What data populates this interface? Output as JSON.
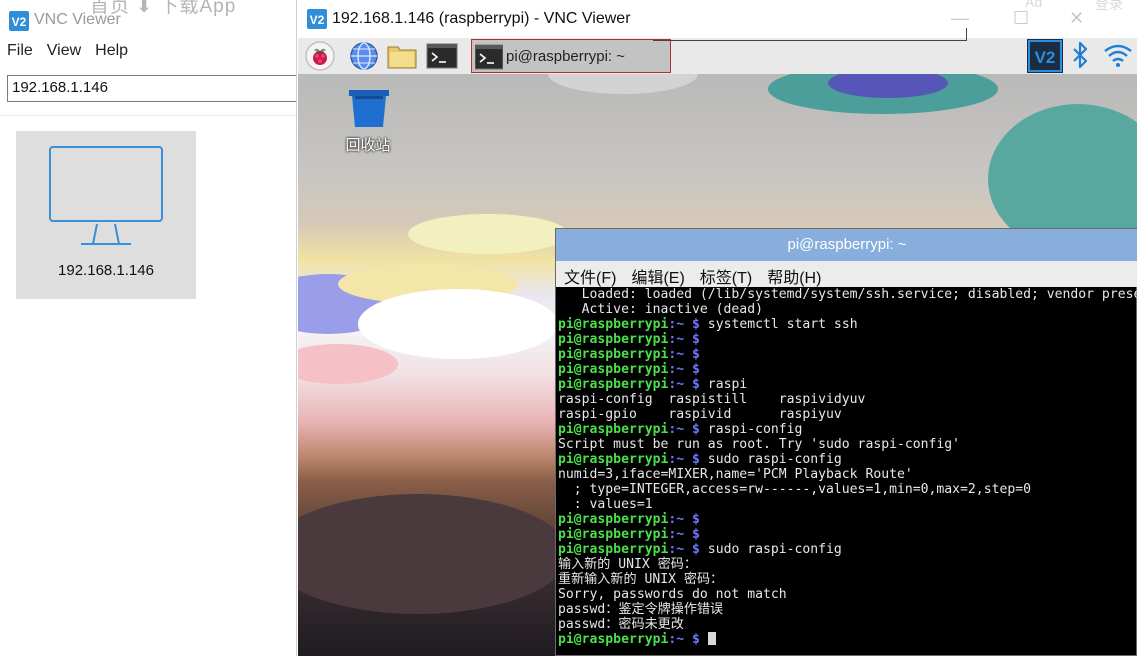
{
  "left_window": {
    "title": "VNC Viewer",
    "ghost_text": "首页  ⬇ 下载App",
    "menu": [
      "File",
      "View",
      "Help"
    ],
    "address_value": "192.168.1.146",
    "tile_label": "192.168.1.146"
  },
  "vnc_window": {
    "title": "192.168.1.146 (raspberrypi) - VNC Viewer",
    "controls": {
      "minimize": "—",
      "maximize": "☐",
      "close": "✕"
    },
    "ghost_ad": "Ad",
    "ghost_login": "登录"
  },
  "pi_panel": {
    "taskbar_label": "pi@raspberrypi: ~"
  },
  "desktop": {
    "trash_label": "回收站"
  },
  "terminal": {
    "title": "pi@raspberrypi: ~",
    "menu": [
      "文件(F)",
      "编辑(E)",
      "标签(T)",
      "帮助(H)"
    ],
    "prompt_user": "pi@raspberrypi",
    "prompt_path": ":~ $",
    "lines": [
      {
        "kind": "out",
        "text": "   Loaded: loaded (/lib/systemd/system/ssh.service; disabled; vendor preset: enabled)"
      },
      {
        "kind": "out",
        "text": "   Active: inactive (dead)"
      },
      {
        "kind": "cmd",
        "text": " systemctl start ssh"
      },
      {
        "kind": "cmd",
        "text": ""
      },
      {
        "kind": "cmd",
        "text": ""
      },
      {
        "kind": "cmd",
        "text": ""
      },
      {
        "kind": "cmd",
        "text": " raspi"
      },
      {
        "kind": "out",
        "text": "raspi-config  raspistill    raspividyuv"
      },
      {
        "kind": "out",
        "text": "raspi-gpio    raspivid      raspiyuv"
      },
      {
        "kind": "cmd",
        "text": " raspi-config"
      },
      {
        "kind": "out",
        "text": "Script must be run as root. Try 'sudo raspi-config'"
      },
      {
        "kind": "cmd",
        "text": " sudo raspi-config"
      },
      {
        "kind": "out",
        "text": "numid=3,iface=MIXER,name='PCM Playback Route'"
      },
      {
        "kind": "out",
        "text": "  ; type=INTEGER,access=rw------,values=1,min=0,max=2,step=0"
      },
      {
        "kind": "out",
        "text": "  : values=1"
      },
      {
        "kind": "cmd",
        "text": ""
      },
      {
        "kind": "cmd",
        "text": ""
      },
      {
        "kind": "cmd",
        "text": " sudo raspi-config"
      },
      {
        "kind": "out",
        "text": "输入新的 UNIX 密码："
      },
      {
        "kind": "out",
        "text": "重新输入新的 UNIX 密码："
      },
      {
        "kind": "out",
        "text": "Sorry, passwords do not match"
      },
      {
        "kind": "out",
        "text": "passwd：鉴定令牌操作错误"
      },
      {
        "kind": "out",
        "text": "passwd：密码未更改"
      },
      {
        "kind": "cmd",
        "text": " ",
        "cursor": true
      }
    ]
  }
}
